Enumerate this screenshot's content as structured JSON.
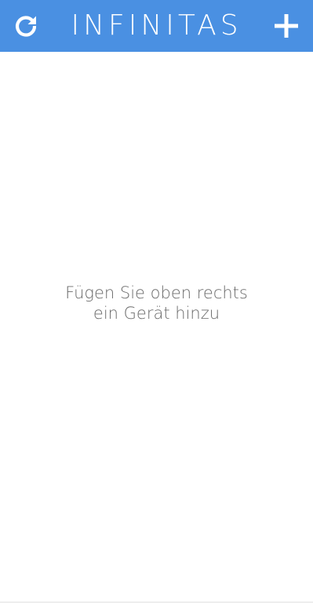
{
  "header": {
    "title": "INFINITAS",
    "refresh_icon": "refresh-icon",
    "add_icon": "plus-icon",
    "background_color": "#4a90e2"
  },
  "main": {
    "empty_message": {
      "line1": "Fügen Sie oben rechts",
      "line2": "ein Gerät hinzu"
    }
  }
}
